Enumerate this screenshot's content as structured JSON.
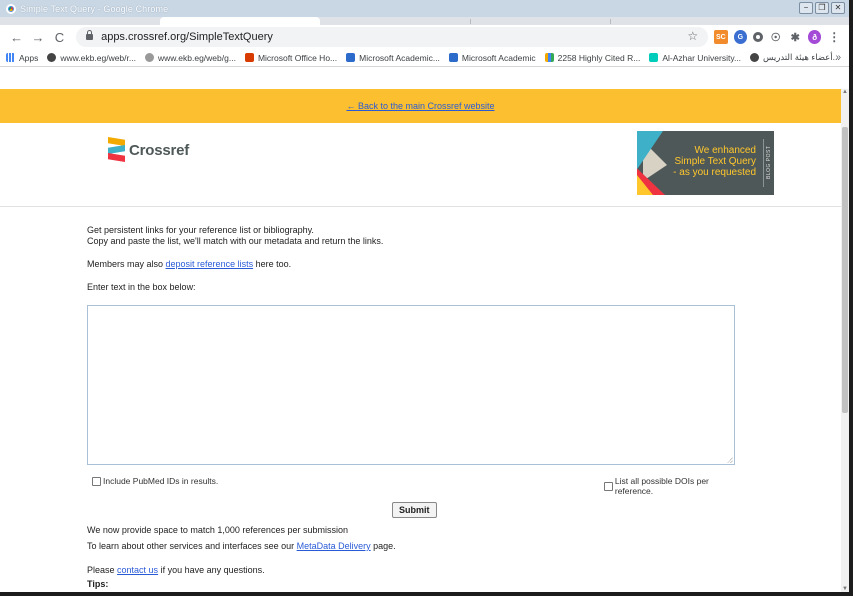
{
  "window": {
    "title": "Simple Text Query - Google Chrome",
    "controls": [
      "−",
      "❐",
      "✕"
    ]
  },
  "toolbar": {
    "back": "←",
    "forward": "→",
    "reload": "C",
    "url": "apps.crossref.org/SimpleTextQuery",
    "star": "☆",
    "extensions": [
      "SC",
      "G",
      "",
      "☉",
      "✱",
      "ð",
      "⋮"
    ]
  },
  "bookmarks": {
    "items": [
      {
        "label": "Apps",
        "icon": "apps-icon"
      },
      {
        "label": "www.ekb.eg/web/r...",
        "icon": "globe-icon"
      },
      {
        "label": "www.ekb.eg/web/g...",
        "icon": "globe-icon"
      },
      {
        "label": "Microsoft Office Ho...",
        "icon": "office-icon"
      },
      {
        "label": "Microsoft Academic...",
        "icon": "microsoft-academic-icon"
      },
      {
        "label": "Microsoft Academic",
        "icon": "microsoft-academic-icon"
      },
      {
        "label": "2258 Highly Cited R...",
        "icon": "bar-chart-icon"
      },
      {
        "label": "Al-Azhar University...",
        "icon": "researchgate-icon"
      },
      {
        "label": "أعضاء هيئة التدريس...",
        "icon": "globe-icon"
      }
    ],
    "more": "»"
  },
  "page": {
    "banner_link": "← Back to the main Crossref website",
    "logo_text": "Crossref",
    "promo": {
      "lines": [
        "We enhanced",
        "Simple Text Query",
        "- as you requested"
      ],
      "tag": "BLOG POST"
    },
    "intro_line1": "Get persistent links for your reference list or bibliography.",
    "intro_line2": "Copy and paste the list, we'll match with our metadata and return the links.",
    "members_prefix": "Members may also ",
    "members_link": "deposit reference lists",
    "members_suffix": " here too.",
    "enter_label": "Enter text in the box below:",
    "textbox_value": "",
    "option_pubmed": "Include PubMed IDs in results.",
    "option_all_dois": "List all possible DOIs per reference.",
    "submit_label": "Submit",
    "capacity_note": "We now provide space to match 1,000 references per submission",
    "learn_prefix": "To learn about other services and interfaces see our ",
    "learn_link": "MetaData Delivery",
    "learn_suffix": " page.",
    "contact_prefix": "Please ",
    "contact_link": "contact us",
    "contact_suffix": " if you have any questions.",
    "tips": "Tips:"
  },
  "colors": {
    "banner": "#fbbf2f",
    "link": "#2a5bd7",
    "promo_bg": "#4f5858",
    "promo_text": "#ffc72c"
  }
}
